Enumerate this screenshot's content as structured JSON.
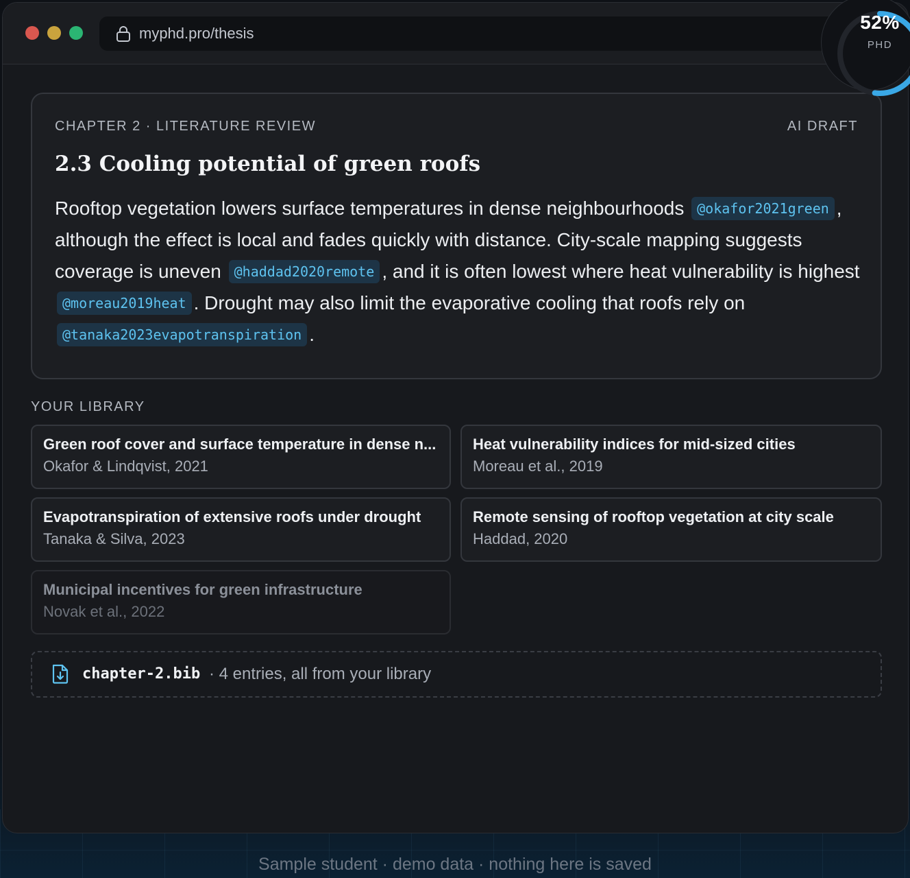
{
  "browser": {
    "url": "myphd.pro/thesis"
  },
  "progress": {
    "value_percent": 52,
    "percent_label": "52%",
    "label": "PHD",
    "color": "#3aa8e6"
  },
  "draft": {
    "eyebrow": "CHAPTER 2 · LITERATURE REVIEW",
    "tag": "AI DRAFT",
    "title": "2.3 Cooling potential of green roofs",
    "paragraph": [
      {
        "text": "Rooftop vegetation lowers surface temperatures in dense neighbourhoods "
      },
      {
        "cite": "@okafor2021green"
      },
      {
        "text": ", although the effect is local and fades quickly with distance. City-scale mapping suggests coverage is uneven "
      },
      {
        "cite": "@haddad2020remote"
      },
      {
        "text": ", and it is often lowest where heat vulnerability is highest "
      },
      {
        "cite": "@moreau2019heat"
      },
      {
        "text": ". Drought may also limit the evaporative cooling that roofs rely on "
      },
      {
        "cite": "@tanaka2023evapotranspiration"
      },
      {
        "text": "."
      }
    ]
  },
  "library": {
    "heading": "YOUR LIBRARY",
    "items": [
      {
        "title": "Green roof cover and surface temperature in dense n...",
        "authors": "Okafor & Lindqvist, 2021",
        "cited": true
      },
      {
        "title": "Heat vulnerability indices for mid-sized cities",
        "authors": "Moreau et al., 2019",
        "cited": true
      },
      {
        "title": "Evapotranspiration of extensive roofs under drought",
        "authors": "Tanaka & Silva, 2023",
        "cited": true
      },
      {
        "title": "Remote sensing of rooftop vegetation at city scale",
        "authors": "Haddad, 2020",
        "cited": true
      },
      {
        "title": "Municipal incentives for green infrastructure",
        "authors": "Novak et al., 2022",
        "cited": false
      }
    ]
  },
  "bib": {
    "icon": "file-download-icon",
    "filename": "chapter-2.bib",
    "meta": "· 4 entries, all from your library"
  },
  "footer": "Sample student · demo data · nothing here is saved"
}
